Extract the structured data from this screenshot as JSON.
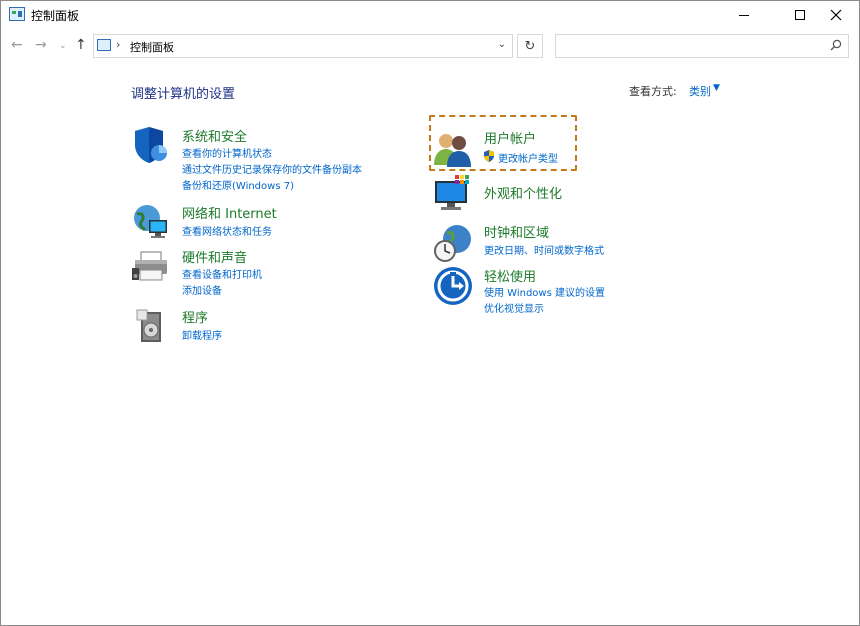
{
  "window": {
    "title": "控制面板",
    "icon": "control-panel-icon"
  },
  "nav": {
    "back": "←",
    "forward": "→",
    "history": "⌄",
    "up": "↑",
    "address": "控制面板",
    "separator": "›",
    "dropdown": "⌄",
    "refresh": "↻",
    "search_placeholder": ""
  },
  "content": {
    "heading": "调整计算机的设置",
    "view_by_label": "查看方式:",
    "view_by_value": "类别",
    "view_by_caret": "▼"
  },
  "left_categories": [
    {
      "title": "系统和安全",
      "icon": "shield-icon",
      "links": [
        "查看你的计算机状态",
        "通过文件历史记录保存你的文件备份副本",
        "备份和还原(Windows 7)"
      ]
    },
    {
      "title": "网络和 Internet",
      "icon": "network-globe-icon",
      "links": [
        "查看网络状态和任务"
      ]
    },
    {
      "title": "硬件和声音",
      "icon": "printer-icon",
      "links": [
        "查看设备和打印机",
        "添加设备"
      ]
    },
    {
      "title": "程序",
      "icon": "programs-icon",
      "links": [
        "卸载程序"
      ]
    }
  ],
  "right_categories": [
    {
      "title": "用户帐户",
      "icon": "users-icon",
      "links": [
        "更改帐户类型"
      ]
    },
    {
      "title": "外观和个性化",
      "icon": "monitor-palette-icon",
      "links": []
    },
    {
      "title": "时钟和区域",
      "icon": "clock-globe-icon",
      "links": [
        "更改日期、时间或数字格式"
      ]
    },
    {
      "title": "轻松使用",
      "icon": "ease-of-access-icon",
      "links": [
        "使用 Windows 建议的设置",
        "优化视觉显示"
      ]
    }
  ],
  "colors": {
    "category_title": "#1c7a2a",
    "link": "#0066cc",
    "heading": "#1e3287",
    "highlight": "#c27a1a"
  }
}
